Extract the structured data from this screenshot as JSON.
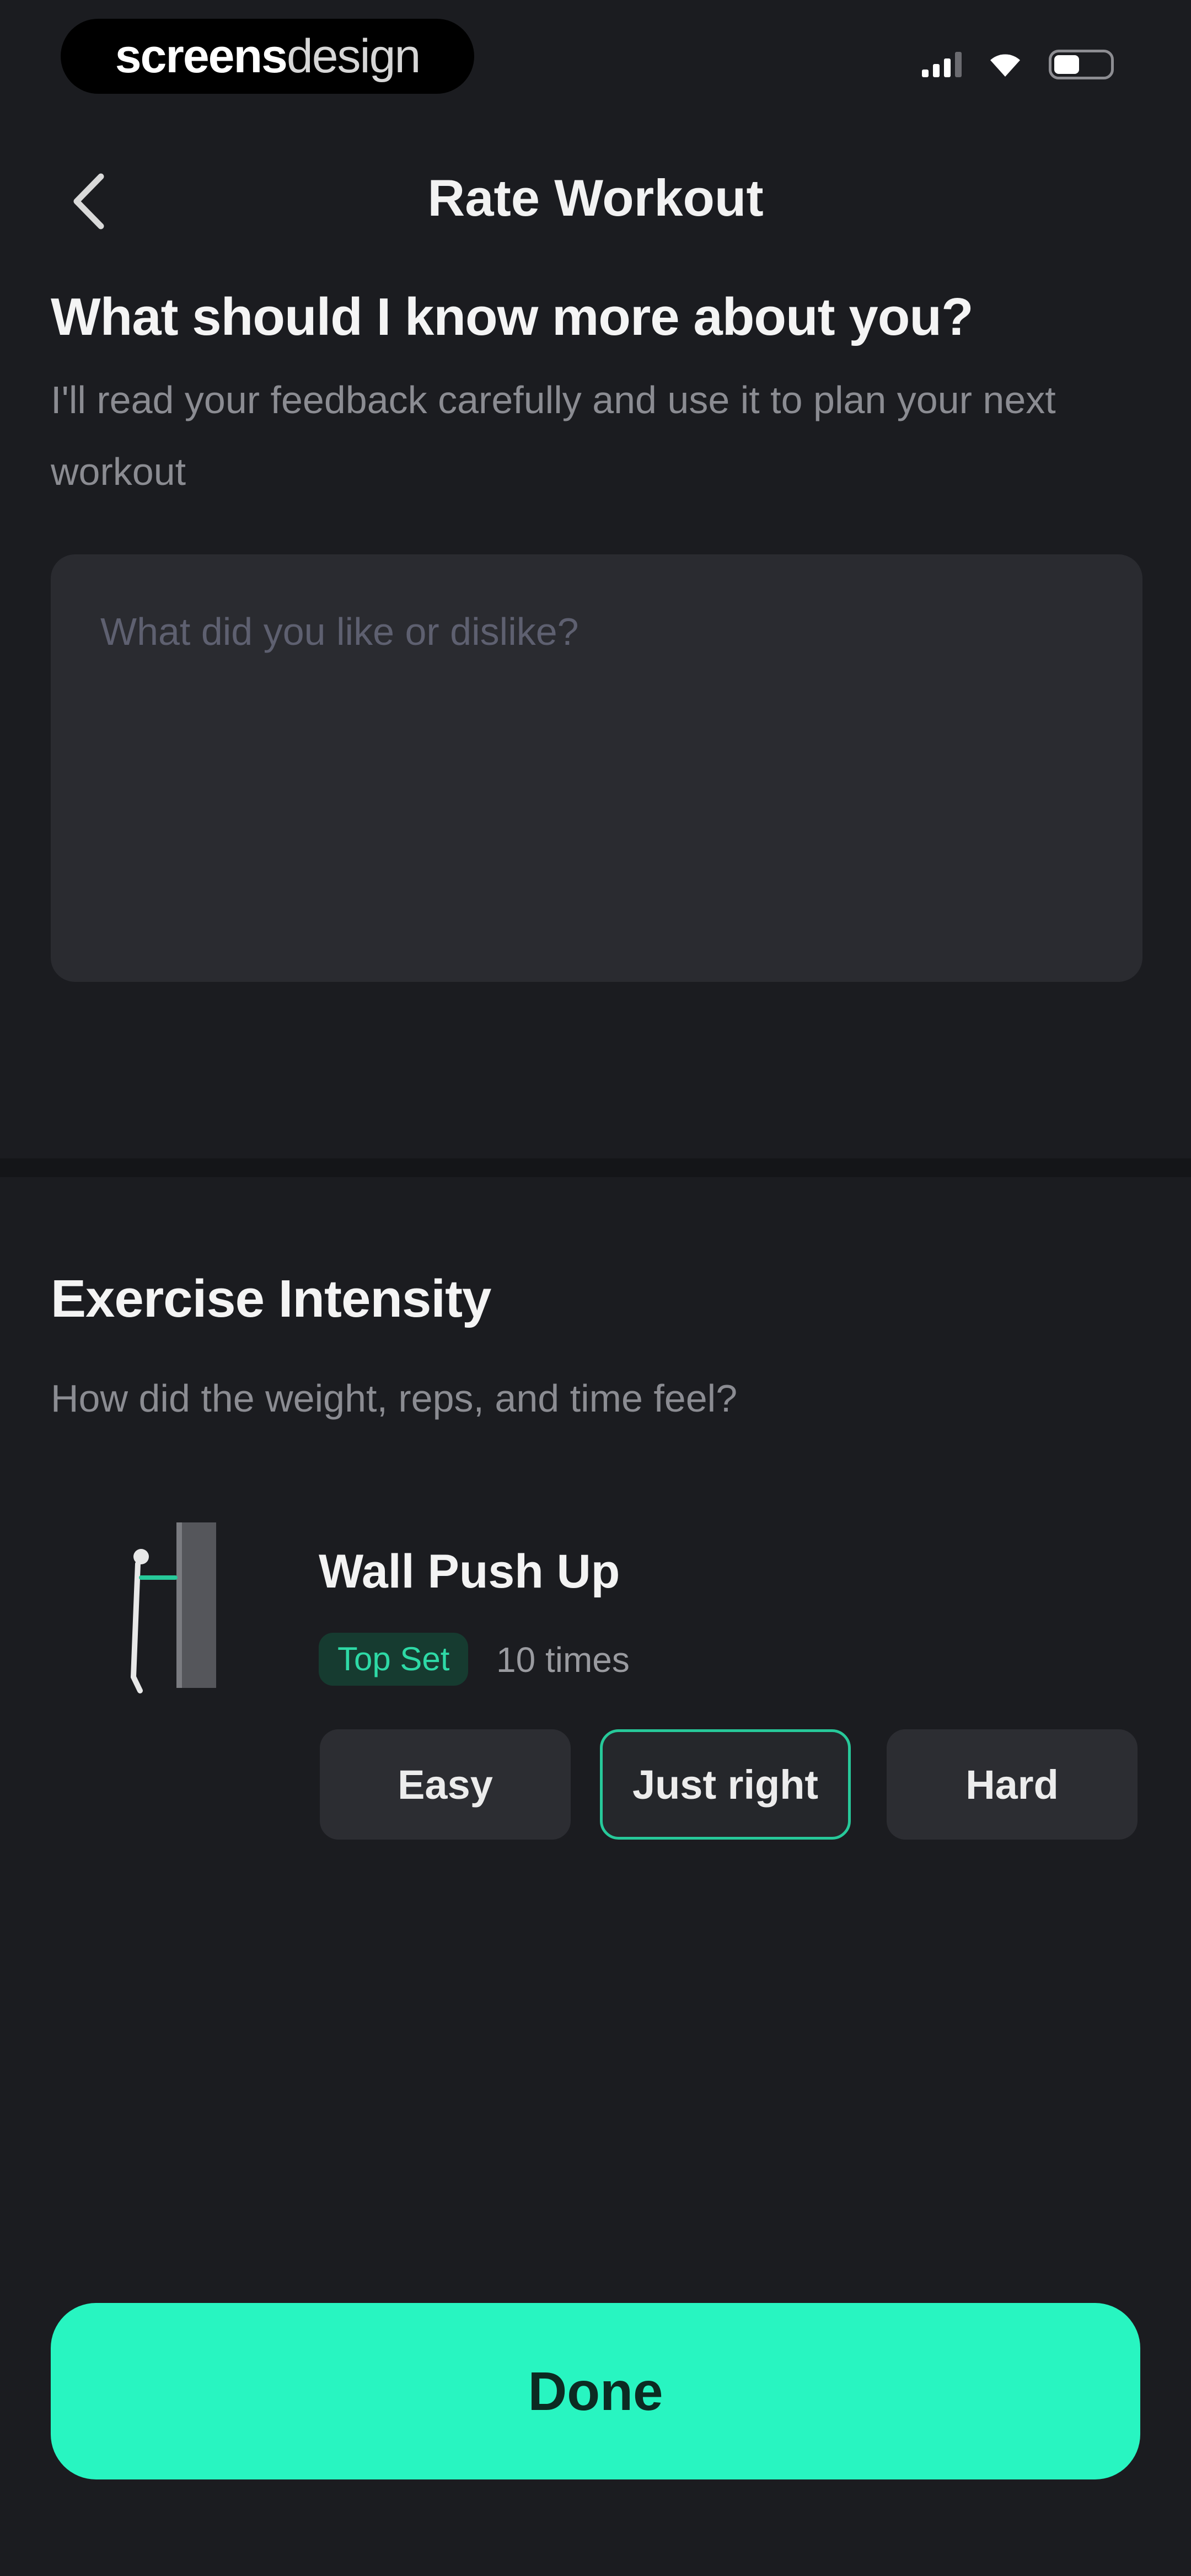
{
  "status_bar": {
    "watermark_bold": "screens",
    "watermark_light": "design"
  },
  "nav": {
    "title": "Rate Workout"
  },
  "feedback": {
    "title": "What should I know more about you?",
    "subtitle": "I'll read your feedback carefully and use it to plan your next workout",
    "placeholder": "What did you like or dislike?",
    "value": ""
  },
  "intensity": {
    "title": "Exercise Intensity",
    "subtitle": "How did the weight, reps, and time feel?",
    "exercise": {
      "name": "Wall Push Up",
      "tag": "Top Set",
      "reps": "10 times"
    },
    "options": [
      "Easy",
      "Just right",
      "Hard"
    ],
    "selected": "Just right"
  },
  "done_label": "Done",
  "colors": {
    "background": "#1b1c20",
    "accent": "#28f5c1",
    "selected_border": "#27c99a",
    "tag_text": "#2ed9a6"
  }
}
